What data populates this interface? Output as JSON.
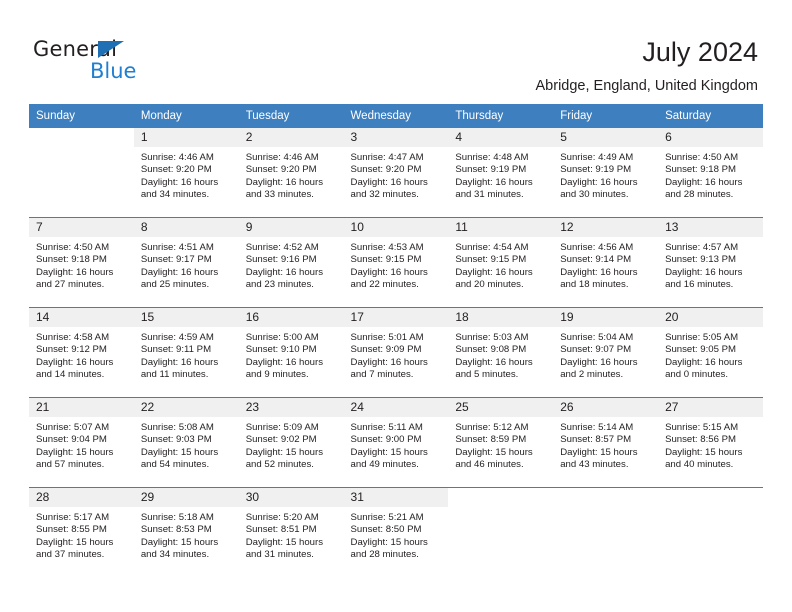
{
  "brand": {
    "name_part1": "General",
    "name_part2": "Blue",
    "accent_color": "#1f7fd0",
    "triangle_color": "#1f6fb5"
  },
  "header": {
    "title": "July 2024",
    "subtitle": "Abridge, England, United Kingdom"
  },
  "calendar": {
    "header_background": "#3d7fbf",
    "daynum_background": "#f0f0f0",
    "weekday_headers": [
      "Sunday",
      "Monday",
      "Tuesday",
      "Wednesday",
      "Thursday",
      "Friday",
      "Saturday"
    ],
    "weeks": [
      [
        {
          "day": "",
          "sunrise": "",
          "sunset": "",
          "daylight_line1": "",
          "daylight_line2": "",
          "blank": true
        },
        {
          "day": "1",
          "sunrise": "Sunrise: 4:46 AM",
          "sunset": "Sunset: 9:20 PM",
          "daylight_line1": "Daylight: 16 hours",
          "daylight_line2": "and 34 minutes."
        },
        {
          "day": "2",
          "sunrise": "Sunrise: 4:46 AM",
          "sunset": "Sunset: 9:20 PM",
          "daylight_line1": "Daylight: 16 hours",
          "daylight_line2": "and 33 minutes."
        },
        {
          "day": "3",
          "sunrise": "Sunrise: 4:47 AM",
          "sunset": "Sunset: 9:20 PM",
          "daylight_line1": "Daylight: 16 hours",
          "daylight_line2": "and 32 minutes."
        },
        {
          "day": "4",
          "sunrise": "Sunrise: 4:48 AM",
          "sunset": "Sunset: 9:19 PM",
          "daylight_line1": "Daylight: 16 hours",
          "daylight_line2": "and 31 minutes."
        },
        {
          "day": "5",
          "sunrise": "Sunrise: 4:49 AM",
          "sunset": "Sunset: 9:19 PM",
          "daylight_line1": "Daylight: 16 hours",
          "daylight_line2": "and 30 minutes."
        },
        {
          "day": "6",
          "sunrise": "Sunrise: 4:50 AM",
          "sunset": "Sunset: 9:18 PM",
          "daylight_line1": "Daylight: 16 hours",
          "daylight_line2": "and 28 minutes."
        }
      ],
      [
        {
          "day": "7",
          "sunrise": "Sunrise: 4:50 AM",
          "sunset": "Sunset: 9:18 PM",
          "daylight_line1": "Daylight: 16 hours",
          "daylight_line2": "and 27 minutes."
        },
        {
          "day": "8",
          "sunrise": "Sunrise: 4:51 AM",
          "sunset": "Sunset: 9:17 PM",
          "daylight_line1": "Daylight: 16 hours",
          "daylight_line2": "and 25 minutes."
        },
        {
          "day": "9",
          "sunrise": "Sunrise: 4:52 AM",
          "sunset": "Sunset: 9:16 PM",
          "daylight_line1": "Daylight: 16 hours",
          "daylight_line2": "and 23 minutes."
        },
        {
          "day": "10",
          "sunrise": "Sunrise: 4:53 AM",
          "sunset": "Sunset: 9:15 PM",
          "daylight_line1": "Daylight: 16 hours",
          "daylight_line2": "and 22 minutes."
        },
        {
          "day": "11",
          "sunrise": "Sunrise: 4:54 AM",
          "sunset": "Sunset: 9:15 PM",
          "daylight_line1": "Daylight: 16 hours",
          "daylight_line2": "and 20 minutes."
        },
        {
          "day": "12",
          "sunrise": "Sunrise: 4:56 AM",
          "sunset": "Sunset: 9:14 PM",
          "daylight_line1": "Daylight: 16 hours",
          "daylight_line2": "and 18 minutes."
        },
        {
          "day": "13",
          "sunrise": "Sunrise: 4:57 AM",
          "sunset": "Sunset: 9:13 PM",
          "daylight_line1": "Daylight: 16 hours",
          "daylight_line2": "and 16 minutes."
        }
      ],
      [
        {
          "day": "14",
          "sunrise": "Sunrise: 4:58 AM",
          "sunset": "Sunset: 9:12 PM",
          "daylight_line1": "Daylight: 16 hours",
          "daylight_line2": "and 14 minutes."
        },
        {
          "day": "15",
          "sunrise": "Sunrise: 4:59 AM",
          "sunset": "Sunset: 9:11 PM",
          "daylight_line1": "Daylight: 16 hours",
          "daylight_line2": "and 11 minutes."
        },
        {
          "day": "16",
          "sunrise": "Sunrise: 5:00 AM",
          "sunset": "Sunset: 9:10 PM",
          "daylight_line1": "Daylight: 16 hours",
          "daylight_line2": "and 9 minutes."
        },
        {
          "day": "17",
          "sunrise": "Sunrise: 5:01 AM",
          "sunset": "Sunset: 9:09 PM",
          "daylight_line1": "Daylight: 16 hours",
          "daylight_line2": "and 7 minutes."
        },
        {
          "day": "18",
          "sunrise": "Sunrise: 5:03 AM",
          "sunset": "Sunset: 9:08 PM",
          "daylight_line1": "Daylight: 16 hours",
          "daylight_line2": "and 5 minutes."
        },
        {
          "day": "19",
          "sunrise": "Sunrise: 5:04 AM",
          "sunset": "Sunset: 9:07 PM",
          "daylight_line1": "Daylight: 16 hours",
          "daylight_line2": "and 2 minutes."
        },
        {
          "day": "20",
          "sunrise": "Sunrise: 5:05 AM",
          "sunset": "Sunset: 9:05 PM",
          "daylight_line1": "Daylight: 16 hours",
          "daylight_line2": "and 0 minutes."
        }
      ],
      [
        {
          "day": "21",
          "sunrise": "Sunrise: 5:07 AM",
          "sunset": "Sunset: 9:04 PM",
          "daylight_line1": "Daylight: 15 hours",
          "daylight_line2": "and 57 minutes."
        },
        {
          "day": "22",
          "sunrise": "Sunrise: 5:08 AM",
          "sunset": "Sunset: 9:03 PM",
          "daylight_line1": "Daylight: 15 hours",
          "daylight_line2": "and 54 minutes."
        },
        {
          "day": "23",
          "sunrise": "Sunrise: 5:09 AM",
          "sunset": "Sunset: 9:02 PM",
          "daylight_line1": "Daylight: 15 hours",
          "daylight_line2": "and 52 minutes."
        },
        {
          "day": "24",
          "sunrise": "Sunrise: 5:11 AM",
          "sunset": "Sunset: 9:00 PM",
          "daylight_line1": "Daylight: 15 hours",
          "daylight_line2": "and 49 minutes."
        },
        {
          "day": "25",
          "sunrise": "Sunrise: 5:12 AM",
          "sunset": "Sunset: 8:59 PM",
          "daylight_line1": "Daylight: 15 hours",
          "daylight_line2": "and 46 minutes."
        },
        {
          "day": "26",
          "sunrise": "Sunrise: 5:14 AM",
          "sunset": "Sunset: 8:57 PM",
          "daylight_line1": "Daylight: 15 hours",
          "daylight_line2": "and 43 minutes."
        },
        {
          "day": "27",
          "sunrise": "Sunrise: 5:15 AM",
          "sunset": "Sunset: 8:56 PM",
          "daylight_line1": "Daylight: 15 hours",
          "daylight_line2": "and 40 minutes."
        }
      ],
      [
        {
          "day": "28",
          "sunrise": "Sunrise: 5:17 AM",
          "sunset": "Sunset: 8:55 PM",
          "daylight_line1": "Daylight: 15 hours",
          "daylight_line2": "and 37 minutes."
        },
        {
          "day": "29",
          "sunrise": "Sunrise: 5:18 AM",
          "sunset": "Sunset: 8:53 PM",
          "daylight_line1": "Daylight: 15 hours",
          "daylight_line2": "and 34 minutes."
        },
        {
          "day": "30",
          "sunrise": "Sunrise: 5:20 AM",
          "sunset": "Sunset: 8:51 PM",
          "daylight_line1": "Daylight: 15 hours",
          "daylight_line2": "and 31 minutes."
        },
        {
          "day": "31",
          "sunrise": "Sunrise: 5:21 AM",
          "sunset": "Sunset: 8:50 PM",
          "daylight_line1": "Daylight: 15 hours",
          "daylight_line2": "and 28 minutes."
        },
        {
          "day": "",
          "sunrise": "",
          "sunset": "",
          "daylight_line1": "",
          "daylight_line2": "",
          "blank": true
        },
        {
          "day": "",
          "sunrise": "",
          "sunset": "",
          "daylight_line1": "",
          "daylight_line2": "",
          "blank": true
        },
        {
          "day": "",
          "sunrise": "",
          "sunset": "",
          "daylight_line1": "",
          "daylight_line2": "",
          "blank": true
        }
      ]
    ]
  }
}
